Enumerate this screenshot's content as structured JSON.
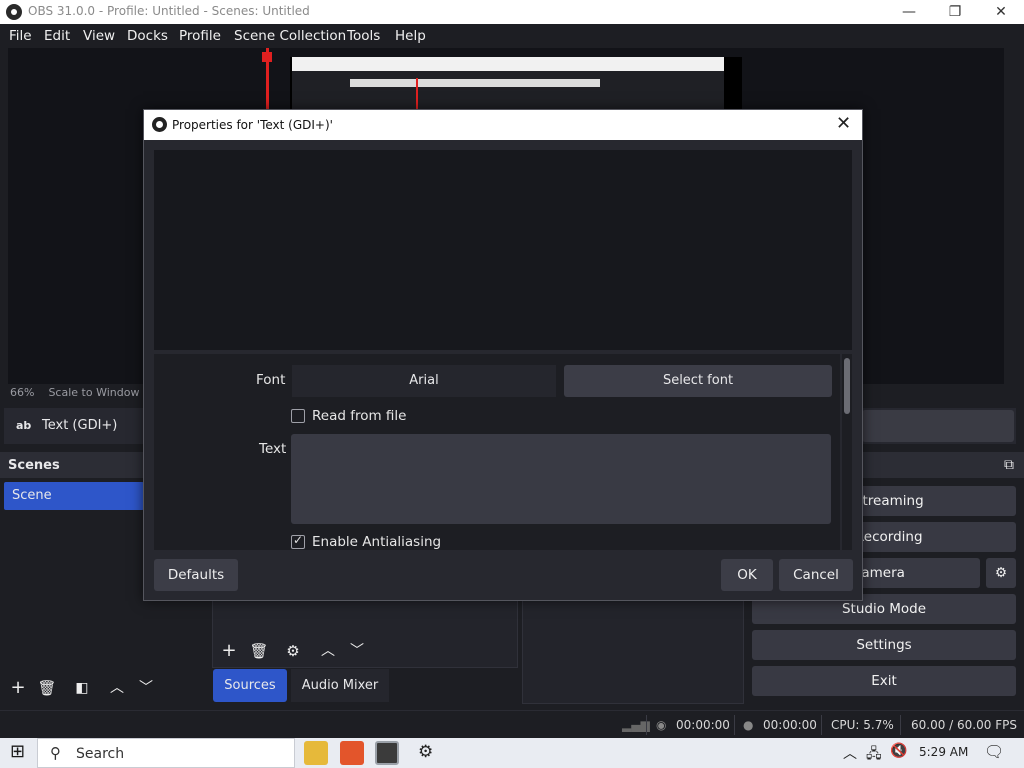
{
  "window": {
    "title": "OBS 31.0.0 - Profile: Untitled - Scenes: Untitled",
    "min_glyph": "—",
    "restore_glyph": "❐",
    "close_glyph": "✕"
  },
  "menu": [
    "File",
    "Edit",
    "View",
    "Docks",
    "Profile",
    "Scene Collection",
    "Tools",
    "Help"
  ],
  "preview": {
    "zoom": "66%",
    "scale_mode": "Scale to Window"
  },
  "source_bar": {
    "icon_label": "ab",
    "name": "Text (GDI+)"
  },
  "scenes": {
    "title": "Scenes",
    "items": [
      "Scene"
    ]
  },
  "tabs": {
    "sources": "Sources",
    "audio_mixer": "Audio Mixer"
  },
  "controls": {
    "start_streaming": "t Streaming",
    "start_recording": "t Recording",
    "virtual_camera": "ual Camera",
    "studio_mode": "Studio Mode",
    "settings": "Settings",
    "exit": "Exit"
  },
  "status": {
    "stream_time": "00:00:00",
    "record_time": "00:00:00",
    "cpu": "CPU: 5.7%",
    "fps": "60.00 / 60.00 FPS"
  },
  "taskbar": {
    "search_label": "Search",
    "time": "5:29 AM"
  },
  "dialog": {
    "title": "Properties for 'Text (GDI+)'",
    "font_label": "Font",
    "font_value": "Arial",
    "select_font": "Select font",
    "read_from_file": "Read from file",
    "read_from_file_checked": false,
    "text_label": "Text",
    "text_value": "",
    "enable_antialiasing": "Enable Antialiasing",
    "enable_antialiasing_checked": true,
    "defaults": "Defaults",
    "ok": "OK",
    "cancel": "Cancel"
  },
  "colors": {
    "accent": "#2e56c9",
    "background": "#1d1e23",
    "panel": "#27282f",
    "button": "#3c3d47"
  }
}
